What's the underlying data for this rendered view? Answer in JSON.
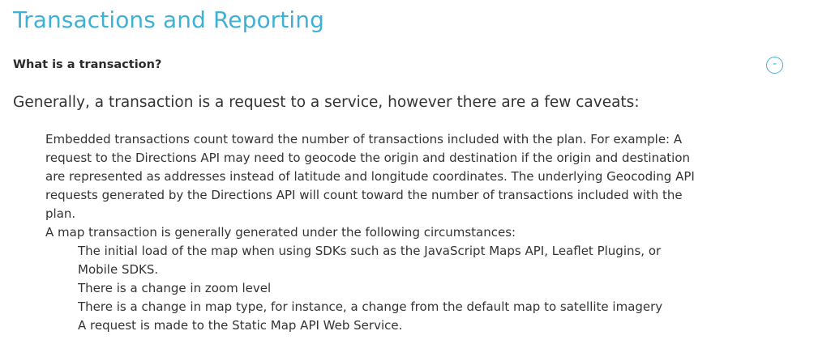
{
  "section": {
    "title": "Transactions and Reporting"
  },
  "faq": {
    "question": "What is a transaction?",
    "toggle_symbol": "-",
    "intro": "Generally, a transaction is a request to a service, however there are a few caveats:",
    "embedded_paragraph": "Embedded transactions count toward the number of transactions included with the plan. For example: A request to the Directions API may need to geocode the origin and destination if the origin and destination are represented as addresses instead of latitude and longitude coordinates. The underlying Geocoding API requests generated by the Directions API will count toward the number of transactions included with the plan.",
    "map_transaction_lead": "A map transaction is generally generated under the following circumstances:",
    "circumstances": [
      "The initial load of the map when using SDKs such as the JavaScript Maps API, Leaflet Plugins, or Mobile SDKS.",
      "There is a change in zoom level",
      "There is a change in map type, for instance, a change from the default map to satellite imagery",
      "A request is made to the Static Map API Web Service."
    ]
  },
  "colors": {
    "accent": "#3fb1d4",
    "text": "#333333",
    "background": "#ffffff"
  },
  "icons": {
    "toggle": "collapse-icon"
  }
}
